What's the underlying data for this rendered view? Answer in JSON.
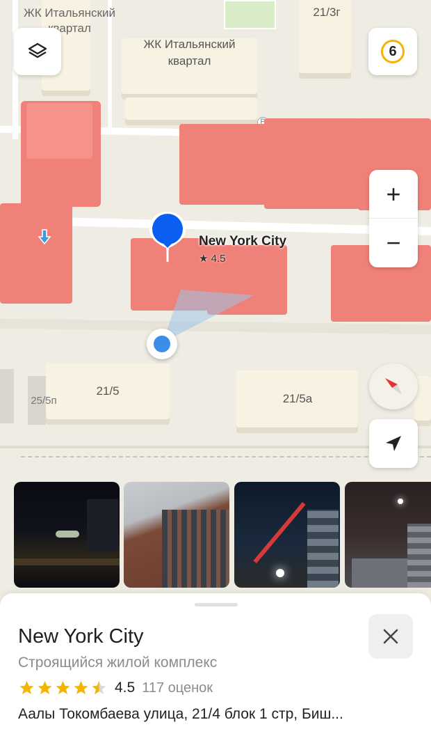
{
  "map": {
    "labels": {
      "italian_quarter_top": "ЖК Итальянский квартал",
      "italian_quarter": "ЖК Итальянский квартал",
      "building_21_3g": "21/3г",
      "building_21_5": "21/5",
      "building_21_5a": "21/5а",
      "building_25_5p": "25/5п"
    },
    "parking_label": "P",
    "traffic_level": "6",
    "zoom_in_label": "+",
    "zoom_out_label": "−"
  },
  "pin": {
    "name": "New York City",
    "rating": "★ 4.5"
  },
  "sheet": {
    "title": "New York City",
    "subtitle": "Строящийся жилой комплекс",
    "rating_value": "4.5",
    "rating_count": "117 оценок",
    "stars_value": 4.5,
    "address": "Аалы Токомбаева улица, 21/4 блок 1 стр, Биш..."
  },
  "colors": {
    "building_red": "#f6928a",
    "pin_blue": "#0a5ff0",
    "star_gold": "#f4b400",
    "compass_red": "#e63232"
  }
}
